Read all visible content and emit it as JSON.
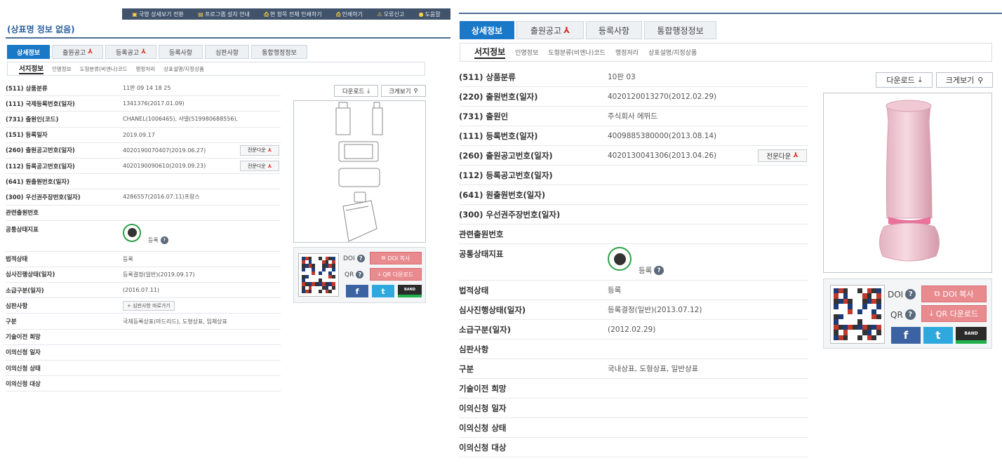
{
  "left": {
    "topbar": [
      "국영 상세보기 전환",
      "프로그램 설치 안내",
      "현 항목 전체 인쇄하기",
      "인쇄하기",
      "오류신고",
      "도움말"
    ],
    "title": "(상표명 정보 없음)",
    "tabs": [
      "상세정보",
      "출원공고",
      "등록공고",
      "등록사항",
      "심판사항",
      "통합행정정보"
    ],
    "subtabs": [
      "서지정보",
      "인명정보",
      "도형분류(비엔나)코드",
      "행정처리",
      "상표설명/지정상품"
    ],
    "rows": [
      {
        "label": "(511) 상품분류",
        "value": "11판     09 14 18 25"
      },
      {
        "label": "(111) 국제등록번호(일자)",
        "value": "1341376(2017.01.09)"
      },
      {
        "label": "(731) 출원인(코드)",
        "value": "CHANEL(1006465), 샤넬(519980688556),"
      },
      {
        "label": "(151) 등록일자",
        "value": "2019.09.17"
      },
      {
        "label": "(260) 출원공고번호(일자)",
        "value": "4020190070407(2019.06.27)"
      },
      {
        "label": "(112) 등록공고번호(일자)",
        "value": "4020190090610(2019.09.23)"
      },
      {
        "label": "(641) 원출원번호(일자)",
        "value": ""
      },
      {
        "label": "(300) 우선권주장번호(일자)",
        "value": "4286557(2016.07.11)프랑스"
      },
      {
        "label": "관련출원번호",
        "value": ""
      },
      {
        "label": "공통상태지표",
        "value": "등록"
      },
      {
        "label": "법적상태",
        "value": "등록"
      },
      {
        "label": "심사진행상태(일자)",
        "value": "등록결정(일반)(2019.09.17)"
      },
      {
        "label": "소급구분(일자)",
        "value": "(2016.07.11)"
      },
      {
        "label": "심판사항",
        "value": "+ 심판사항 바로가기"
      },
      {
        "label": "구분",
        "value": "국제등록상표(마드리드), 도형상표, 입체상표"
      },
      {
        "label": "기술이전 희망",
        "value": ""
      },
      {
        "label": "이의신청 일자",
        "value": ""
      },
      {
        "label": "이의신청 상태",
        "value": ""
      },
      {
        "label": "이의신청 대상",
        "value": ""
      }
    ],
    "fulltext_btn": "전문다운",
    "download": "다운로드",
    "zoom": "크게보기",
    "doi": "DOI",
    "qr": "QR",
    "doi_copy": "DOI 복사",
    "qr_down": "QR 다운로드",
    "facebook": "f",
    "twitter": "t",
    "band": "BAND"
  },
  "right": {
    "tabs": [
      "상세정보",
      "출원공고",
      "등록사항",
      "통합행정정보"
    ],
    "subtabs": [
      "서지정보",
      "인명정보",
      "도형분류(비엔나)코드",
      "행정처리",
      "상표설명/지정상품"
    ],
    "rows": [
      {
        "label": "(511) 상품분류",
        "value": "10판        03"
      },
      {
        "label": "(220) 출원번호(일자)",
        "value": "4020120013270(2012.02.29)"
      },
      {
        "label": "(731) 출원인",
        "value": "주식회사 에뛰드"
      },
      {
        "label": "(111) 등록번호(일자)",
        "value": "4009885380000(2013.08.14)"
      },
      {
        "label": "(260) 출원공고번호(일자)",
        "value": "4020130041306(2013.04.26)"
      },
      {
        "label": "(112) 등록공고번호(일자)",
        "value": ""
      },
      {
        "label": "(641) 원출원번호(일자)",
        "value": ""
      },
      {
        "label": "(300) 우선권주장번호(일자)",
        "value": ""
      },
      {
        "label": "관련출원번호",
        "value": ""
      },
      {
        "label": "공통상태지표",
        "value": "등록"
      },
      {
        "label": "법적상태",
        "value": "등록"
      },
      {
        "label": "심사진행상태(일자)",
        "value": "등록결정(일반)(2013.07.12)"
      },
      {
        "label": "소급구분(일자)",
        "value": "(2012.02.29)"
      },
      {
        "label": "심판사항",
        "value": ""
      },
      {
        "label": "구분",
        "value": "국내상표, 도형상표, 일반상표"
      },
      {
        "label": "기술이전 희망",
        "value": ""
      },
      {
        "label": "이의신청 일자",
        "value": ""
      },
      {
        "label": "이의신청 상태",
        "value": ""
      },
      {
        "label": "이의신청 대상",
        "value": ""
      }
    ],
    "fulltext_btn": "전문다운",
    "download": "다운로드",
    "zoom": "크게보기",
    "doi": "DOI",
    "qr": "QR",
    "doi_copy": "DOI 복사",
    "qr_down": "QR 다운로드",
    "facebook": "f",
    "twitter": "t",
    "band": "BAND"
  },
  "colors": {
    "accent": "#1a78c8",
    "pink": "#e98a8e",
    "badge": "#2d9e47",
    "facebook": "#3b62a3",
    "twitter": "#2fa8de"
  }
}
